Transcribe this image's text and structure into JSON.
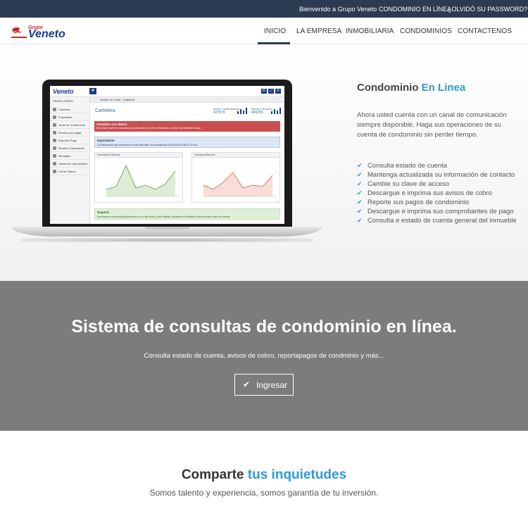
{
  "topbar": {
    "welcome": "Bienvenido a Grupo Veneto",
    "condominio": "CONDOMINIO EN LÍNEA",
    "forgot": "¿OLVIDÓ SU PASSWORD?"
  },
  "logo": {
    "small": "Grupo",
    "main": "Veneto"
  },
  "nav": {
    "items": [
      "INICIO",
      "LA EMPRESA",
      "INMOBILIARIA",
      "CONDOMINIOS",
      "CONTACTENOS"
    ],
    "active": "INICIO"
  },
  "screen": {
    "brand": "Veneto",
    "user": "PEDRO PEREZ",
    "breadcrumb": "Veneto en Línea · Cartelera",
    "title": "Cartelera",
    "stats": [
      {
        "label": "Monto Facturaciones",
        "value": "427579"
      },
      {
        "label": "Monto Cobranza",
        "value": "449355"
      }
    ],
    "sidebar_items": [
      "Cartelera",
      "Propietario",
      "Junta de Condominio",
      "Recibos por pagar",
      "Reportar Pago",
      "Recibos Cancelados",
      "Mensajes",
      "Históricos Operaciones",
      "Cerrar Sesión"
    ],
    "alert_red": {
      "title": "Actualice sus datos!",
      "text": "Recuerde mantener actualizado su dirección de correo electrónico y número de teléfono celular."
    },
    "alert_blue": {
      "title": "Importante!",
      "text": "La información que encuentra en este sitio web, fue actualizada el 03/12/2015 08:31:23 a.m."
    },
    "chart_titles": [
      "Facturación Mensual",
      "Cobranza Mensual"
    ],
    "support": {
      "title": "Soporte",
      "text": "Escríbanos a soporte@grupoveneto.com a las horas y días hábiles. Ayúdenos a brindarle el servicio que usted se merece"
    }
  },
  "hero": {
    "title_plain": "Condominio",
    "title_accent": "En Linea",
    "description": "Ahora usted cuenta con un canal de comunicación siempre disponible. Haga sus operaciones de su cuenta de condominio sin perder tiempo.",
    "features": [
      "Consulta estado de cuenta",
      "Mantenga actualizada su información de contacto",
      "Cambie su clave de acceso",
      "Descargue e imprima sus avisos de cobro",
      "Reporte sus pagos de condominio",
      "Descargue e imprima sus comprobantes de pago",
      "Consulta e estado de cuenta general del inmueble"
    ]
  },
  "band": {
    "title": "Sistema de consultas de condominio en línea.",
    "subtitle": "Consulta estado de cuenta, avisos de cobro, reportapagos de condminio y más...",
    "button": "Ingresar"
  },
  "bottom": {
    "title_plain": "Comparte",
    "title_accent": "tus inquietudes",
    "subtitle": "Somos talento y experiencia, somos garantía de tu inversión."
  },
  "colors": {
    "topbar": "#2c3a52",
    "accent": "#2f9ad6",
    "band": "#7c7c7c",
    "alert_red": "#c94f4f"
  }
}
